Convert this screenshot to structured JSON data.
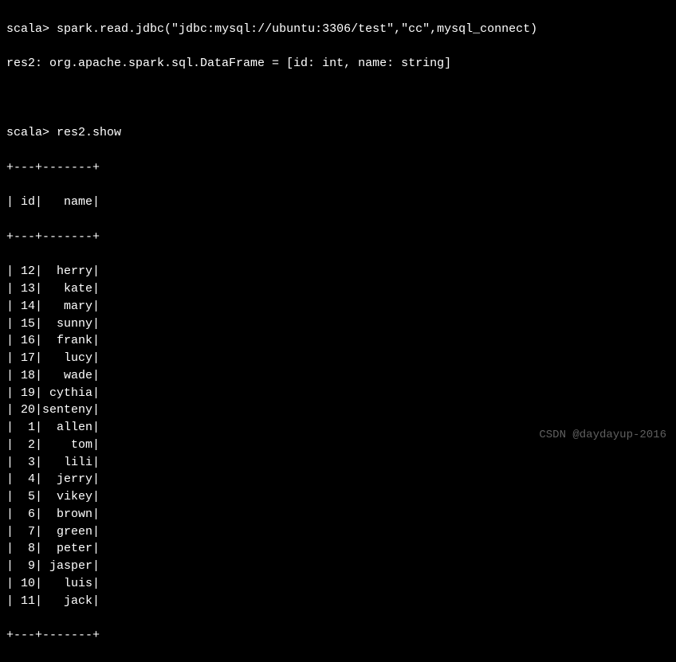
{
  "terminal": {
    "prompt": "scala>",
    "command1": "spark.read.jdbc(\"jdbc:mysql://ubuntu:3306/test\",\"cc\",mysql_connect)",
    "result1": "res2: org.apache.spark.sql.DataFrame = [id: int, name: string]",
    "command2": "res2.show",
    "table": {
      "border_top": "+---+-------+",
      "header": "| id|   name|",
      "border_mid": "+---+-------+",
      "rows": [
        {
          "id": "12",
          "name": "herry"
        },
        {
          "id": "13",
          "name": "kate"
        },
        {
          "id": "14",
          "name": "mary"
        },
        {
          "id": "15",
          "name": "sunny"
        },
        {
          "id": "16",
          "name": "frank"
        },
        {
          "id": "17",
          "name": "lucy"
        },
        {
          "id": "18",
          "name": "wade"
        },
        {
          "id": "19",
          "name": "cythia"
        },
        {
          "id": "20",
          "name": "senteny"
        },
        {
          "id": "1",
          "name": "allen"
        },
        {
          "id": "2",
          "name": "tom"
        },
        {
          "id": "3",
          "name": "lili"
        },
        {
          "id": "4",
          "name": "jerry"
        },
        {
          "id": "5",
          "name": "vikey"
        },
        {
          "id": "6",
          "name": "brown"
        },
        {
          "id": "7",
          "name": "green"
        },
        {
          "id": "8",
          "name": "peter"
        },
        {
          "id": "9",
          "name": "jasper"
        },
        {
          "id": "10",
          "name": "luis"
        },
        {
          "id": "11",
          "name": "jack"
        }
      ],
      "border_bottom": "+---+-------+"
    }
  },
  "watermark": "CSDN @daydayup-2016"
}
